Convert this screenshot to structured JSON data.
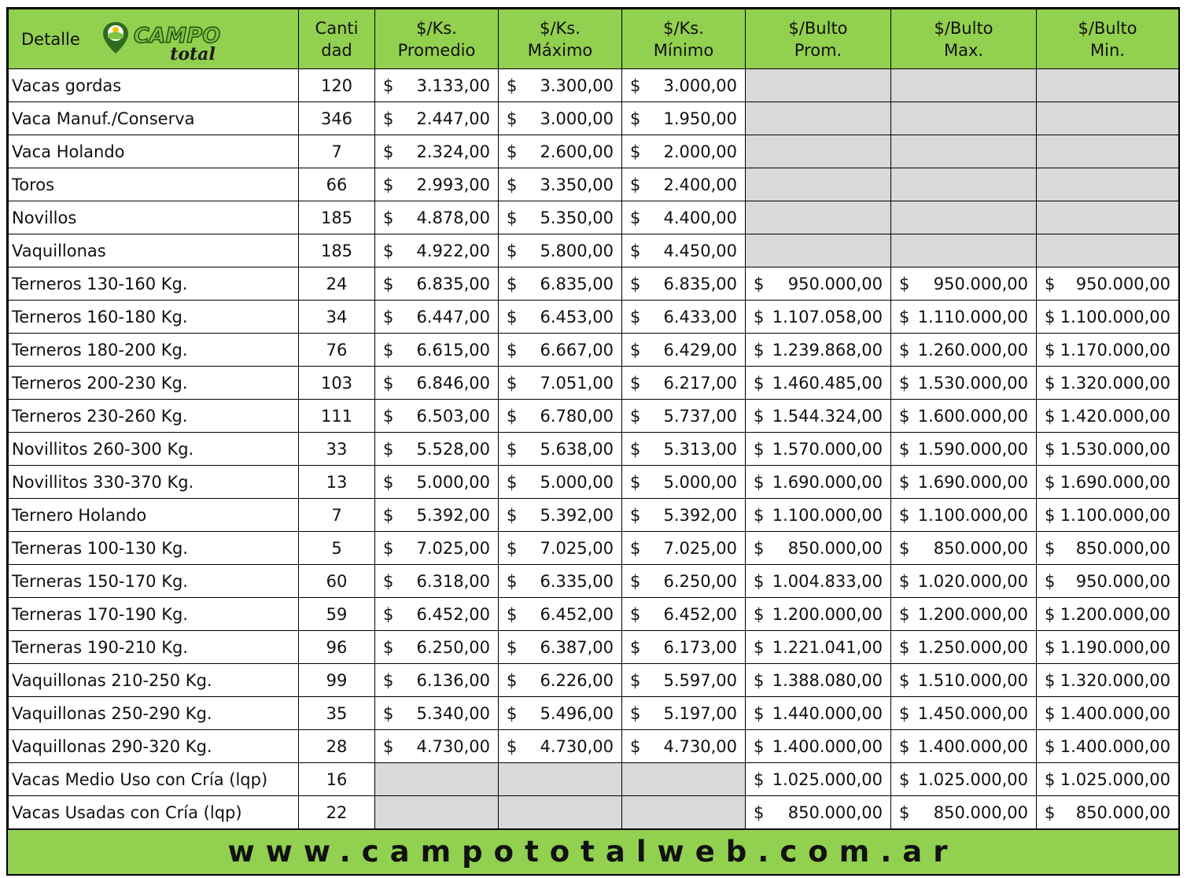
{
  "header": {
    "detalle": "Detalle",
    "logo_text_top": "CAMPO",
    "logo_text_bottom": "total",
    "cantidad": [
      "Canti",
      "dad"
    ],
    "ks_promedio": [
      "$/Ks.",
      "Promedio"
    ],
    "ks_maximo": [
      "$/Ks.",
      "Máximo"
    ],
    "ks_minimo": [
      "$/Ks.",
      "Mínimo"
    ],
    "bulto_prom": [
      "$/Bulto",
      "Prom."
    ],
    "bulto_max": [
      "$/Bulto",
      "Max."
    ],
    "bulto_min": [
      "$/Bulto",
      "Min."
    ]
  },
  "currency_symbol": "$",
  "rows": [
    {
      "name": "Vacas gordas",
      "qty": "120",
      "ks": [
        "3.133,00",
        "3.300,00",
        "3.000,00"
      ],
      "bulto": null
    },
    {
      "name": "Vaca Manuf./Conserva",
      "qty": "346",
      "ks": [
        "2.447,00",
        "3.000,00",
        "1.950,00"
      ],
      "bulto": null
    },
    {
      "name": "Vaca Holando",
      "qty": "7",
      "ks": [
        "2.324,00",
        "2.600,00",
        "2.000,00"
      ],
      "bulto": null
    },
    {
      "name": "Toros",
      "qty": "66",
      "ks": [
        "2.993,00",
        "3.350,00",
        "2.400,00"
      ],
      "bulto": null
    },
    {
      "name": "Novillos",
      "qty": "185",
      "ks": [
        "4.878,00",
        "5.350,00",
        "4.400,00"
      ],
      "bulto": null
    },
    {
      "name": "Vaquillonas",
      "qty": "185",
      "ks": [
        "4.922,00",
        "5.800,00",
        "4.450,00"
      ],
      "bulto": null
    },
    {
      "name": "Terneros 130-160 Kg.",
      "qty": "24",
      "ks": [
        "6.835,00",
        "6.835,00",
        "6.835,00"
      ],
      "bulto": [
        "950.000,00",
        "950.000,00",
        "950.000,00"
      ]
    },
    {
      "name": "Terneros 160-180 Kg.",
      "qty": "34",
      "ks": [
        "6.447,00",
        "6.453,00",
        "6.433,00"
      ],
      "bulto": [
        "1.107.058,00",
        "1.110.000,00",
        "1.100.000,00"
      ]
    },
    {
      "name": "Terneros 180-200 Kg.",
      "qty": "76",
      "ks": [
        "6.615,00",
        "6.667,00",
        "6.429,00"
      ],
      "bulto": [
        "1.239.868,00",
        "1.260.000,00",
        "1.170.000,00"
      ]
    },
    {
      "name": "Terneros 200-230 Kg.",
      "qty": "103",
      "ks": [
        "6.846,00",
        "7.051,00",
        "6.217,00"
      ],
      "bulto": [
        "1.460.485,00",
        "1.530.000,00",
        "1.320.000,00"
      ]
    },
    {
      "name": "Terneros 230-260 Kg.",
      "qty": "111",
      "ks": [
        "6.503,00",
        "6.780,00",
        "5.737,00"
      ],
      "bulto": [
        "1.544.324,00",
        "1.600.000,00",
        "1.420.000,00"
      ]
    },
    {
      "name": "Novillitos 260-300 Kg.",
      "qty": "33",
      "ks": [
        "5.528,00",
        "5.638,00",
        "5.313,00"
      ],
      "bulto": [
        "1.570.000,00",
        "1.590.000,00",
        "1.530.000,00"
      ]
    },
    {
      "name": "Novillitos 330-370 Kg.",
      "qty": "13",
      "ks": [
        "5.000,00",
        "5.000,00",
        "5.000,00"
      ],
      "bulto": [
        "1.690.000,00",
        "1.690.000,00",
        "1.690.000,00"
      ]
    },
    {
      "name": "Ternero Holando",
      "qty": "7",
      "ks": [
        "5.392,00",
        "5.392,00",
        "5.392,00"
      ],
      "bulto": [
        "1.100.000,00",
        "1.100.000,00",
        "1.100.000,00"
      ]
    },
    {
      "name": "Terneras 100-130 Kg.",
      "qty": "5",
      "ks": [
        "7.025,00",
        "7.025,00",
        "7.025,00"
      ],
      "bulto": [
        "850.000,00",
        "850.000,00",
        "850.000,00"
      ]
    },
    {
      "name": "Terneras 150-170 Kg.",
      "qty": "60",
      "ks": [
        "6.318,00",
        "6.335,00",
        "6.250,00"
      ],
      "bulto": [
        "1.004.833,00",
        "1.020.000,00",
        "950.000,00"
      ]
    },
    {
      "name": "Terneras 170-190 Kg.",
      "qty": "59",
      "ks": [
        "6.452,00",
        "6.452,00",
        "6.452,00"
      ],
      "bulto": [
        "1.200.000,00",
        "1.200.000,00",
        "1.200.000,00"
      ]
    },
    {
      "name": "Terneras 190-210 Kg.",
      "qty": "96",
      "ks": [
        "6.250,00",
        "6.387,00",
        "6.173,00"
      ],
      "bulto": [
        "1.221.041,00",
        "1.250.000,00",
        "1.190.000,00"
      ]
    },
    {
      "name": "Vaquillonas 210-250 Kg.",
      "qty": "99",
      "ks": [
        "6.136,00",
        "6.226,00",
        "5.597,00"
      ],
      "bulto": [
        "1.388.080,00",
        "1.510.000,00",
        "1.320.000,00"
      ]
    },
    {
      "name": "Vaquillonas 250-290 Kg.",
      "qty": "35",
      "ks": [
        "5.340,00",
        "5.496,00",
        "5.197,00"
      ],
      "bulto": [
        "1.440.000,00",
        "1.450.000,00",
        "1.400.000,00"
      ]
    },
    {
      "name": "Vaquillonas 290-320 Kg.",
      "qty": "28",
      "ks": [
        "4.730,00",
        "4.730,00",
        "4.730,00"
      ],
      "bulto": [
        "1.400.000,00",
        "1.400.000,00",
        "1.400.000,00"
      ]
    },
    {
      "name": "Vacas Medio Uso con Cría (lqp)",
      "qty": "16",
      "ks": null,
      "bulto": [
        "1.025.000,00",
        "1.025.000,00",
        "1.025.000,00"
      ]
    },
    {
      "name": "Vacas Usadas con Cría (lqp)",
      "qty": "22",
      "ks": null,
      "bulto": [
        "850.000,00",
        "850.000,00",
        "850.000,00"
      ]
    }
  ],
  "footer": {
    "url": "www.campototalweb.com.ar"
  },
  "colors": {
    "header_green": "#92d050",
    "empty_cell_gray": "#d9d9d9",
    "logo_dark_green": "#2e6b1f"
  }
}
